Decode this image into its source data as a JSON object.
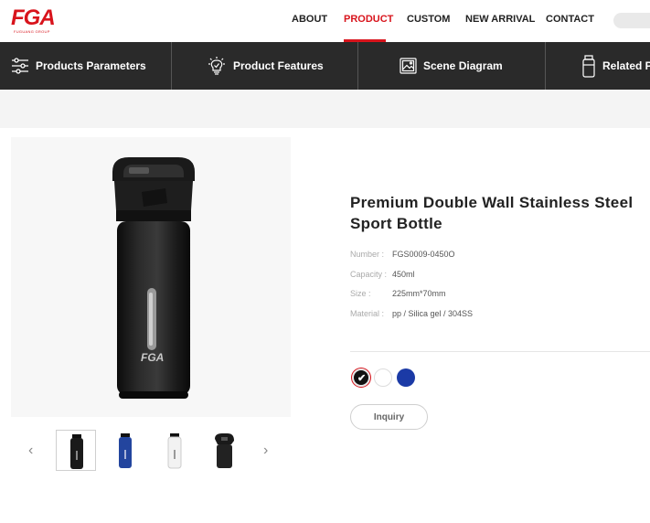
{
  "brand": {
    "logo": "FGA",
    "tagline": "FUGUANG GROUP"
  },
  "nav": {
    "items": [
      {
        "label": "ABOUT"
      },
      {
        "label": "PRODUCT"
      },
      {
        "label": "CUSTOM"
      },
      {
        "label": "NEW ARRIVAL"
      },
      {
        "label": "CONTACT"
      }
    ],
    "active": "PRODUCT"
  },
  "tabs": [
    {
      "label": "Products Parameters",
      "icon": "sliders-icon"
    },
    {
      "label": "Product Features",
      "icon": "lightbulb-icon"
    },
    {
      "label": "Scene Diagram",
      "icon": "image-icon"
    },
    {
      "label": "Related P",
      "icon": "bottle-icon"
    }
  ],
  "product": {
    "title": "Premium Double Wall Stainless Steel Sport Bottle",
    "bottle_brand": "FGA",
    "specs": [
      {
        "label": "Number :",
        "value": "FGS0009-0450O"
      },
      {
        "label": "Capacity :",
        "value": "450ml"
      },
      {
        "label": "Size :",
        "value": "225mm*70mm"
      },
      {
        "label": "Material :",
        "value": "pp / Silica gel / 304SS"
      }
    ],
    "colors": [
      {
        "name": "black",
        "hex": "#111111",
        "selected": true
      },
      {
        "name": "white",
        "hex": "#ffffff",
        "selected": false
      },
      {
        "name": "blue",
        "hex": "#1b3aa6",
        "selected": false
      }
    ],
    "inquiry_label": "Inquiry"
  },
  "gallery": {
    "prev_glyph": "‹",
    "next_glyph": "›",
    "thumbnails": [
      "black",
      "blue",
      "white",
      "black-lid"
    ]
  },
  "colors": {
    "accent": "#d8141c",
    "tabbar": "#2a2a2a"
  }
}
